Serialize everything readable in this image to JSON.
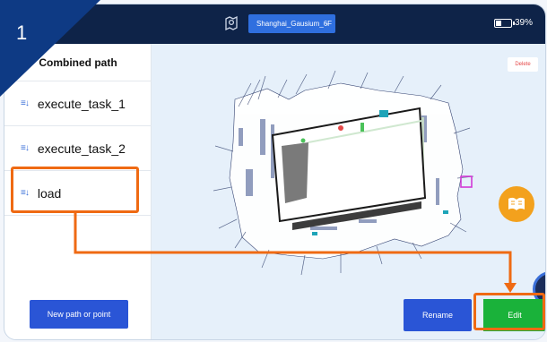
{
  "step_badge": "1",
  "status_bar": {
    "map_name": "Shanghai_Gausium_6F",
    "battery": "39%",
    "battery_level": 0.39
  },
  "sidebar": {
    "title": "Combined path",
    "items": [
      {
        "label": "execute_task_1"
      },
      {
        "label": "execute_task_2"
      },
      {
        "label": "load"
      }
    ],
    "new_button": "New path or point"
  },
  "map": {
    "delete_label": "Delete",
    "rename_label": "Rename",
    "edit_label": "Edit"
  },
  "icons": {
    "path_item": "sort-list-icon",
    "map": "map-pin-icon",
    "dropdown": "chevron-down-icon",
    "battery": "battery-icon",
    "book": "book-icon",
    "joystick": "joystick-icon"
  },
  "colors": {
    "status_bar": "#0e2348",
    "primary_button": "#2a55d6",
    "edit_button": "#1ab23a",
    "highlight": "#ef6a13",
    "delete_text": "#e54848",
    "book_icon": "#f3a11d"
  }
}
